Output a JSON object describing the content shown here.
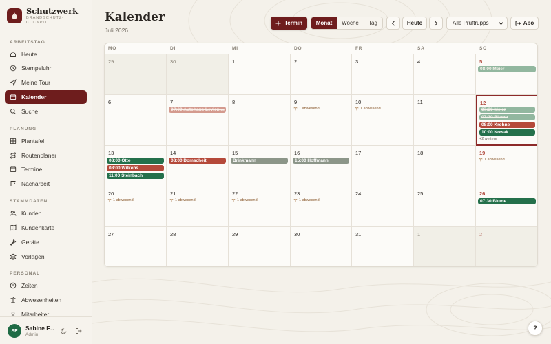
{
  "brand": {
    "title": "Schutzwerk",
    "subtitle": "BRANDSCHUTZ-COCKPIT"
  },
  "sidebar": {
    "sections": [
      "ARBEITSTAG",
      "PLANUNG",
      "STAMMDATEN",
      "PERSONAL"
    ],
    "items": [
      {
        "label": "Heute",
        "icon": "home-icon"
      },
      {
        "label": "Stempeluhr",
        "icon": "clock-icon"
      },
      {
        "label": "Meine Tour",
        "icon": "send-icon"
      },
      {
        "label": "Kalender",
        "icon": "calendar-icon",
        "active": true
      },
      {
        "label": "Suche",
        "icon": "search-icon"
      },
      {
        "label": "Plantafel",
        "icon": "grid-icon"
      },
      {
        "label": "Routenplaner",
        "icon": "route-icon"
      },
      {
        "label": "Termine",
        "icon": "calendar-icon"
      },
      {
        "label": "Nacharbeit",
        "icon": "flag-icon"
      },
      {
        "label": "Kunden",
        "icon": "users-icon"
      },
      {
        "label": "Kundenkarte",
        "icon": "map-icon"
      },
      {
        "label": "Geräte",
        "icon": "wrench-icon"
      },
      {
        "label": "Vorlagen",
        "icon": "layers-icon"
      },
      {
        "label": "Zeiten",
        "icon": "clock-icon"
      },
      {
        "label": "Abwesenheiten",
        "icon": "palm-icon"
      },
      {
        "label": "Mitarbeiter",
        "icon": "user-icon"
      }
    ]
  },
  "user": {
    "initials": "SF",
    "name": "Sabine F...",
    "role": "Admin"
  },
  "header": {
    "title": "Kalender",
    "subtitle": "Juli 2026",
    "new_button": "Termin",
    "views": [
      "Monat",
      "Woche",
      "Tag"
    ],
    "active_view": "Monat",
    "today_button": "Heute",
    "filter_value": "Alle Prüftrupps",
    "abo_button": "Abo"
  },
  "calendar": {
    "weekdays": [
      "MO",
      "DI",
      "MI",
      "DO",
      "FR",
      "SA",
      "SO"
    ],
    "weeks": [
      [
        {
          "day": "29",
          "other": true
        },
        {
          "day": "30",
          "other": true
        },
        {
          "day": "1"
        },
        {
          "day": "2"
        },
        {
          "day": "3"
        },
        {
          "day": "4"
        },
        {
          "day": "5",
          "events": [
            {
              "label": "08:00 Meier",
              "style": "done"
            }
          ]
        }
      ],
      [
        {
          "day": "6"
        },
        {
          "day": "7",
          "events": [
            {
              "label": "07:00 Autohaus Levien ...",
              "style": "done-red"
            }
          ]
        },
        {
          "day": "8"
        },
        {
          "day": "9",
          "absent": "1 abwesend"
        },
        {
          "day": "10",
          "absent": "1 abwesend"
        },
        {
          "day": "11"
        },
        {
          "day": "12",
          "today": true,
          "events": [
            {
              "label": "07:30 Meier",
              "style": "done"
            },
            {
              "label": "07:30 Blume",
              "style": "done"
            },
            {
              "label": "08:00 Krohne",
              "style": "red"
            },
            {
              "label": "10:00 Nowak",
              "style": "green"
            }
          ],
          "more": "+2 weitere"
        }
      ],
      [
        {
          "day": "13",
          "events": [
            {
              "label": "08:00 Otte",
              "style": "green"
            },
            {
              "label": "08:00 Wilkens",
              "style": "red"
            },
            {
              "label": "11:00 Steinbach",
              "style": "green"
            }
          ]
        },
        {
          "day": "14",
          "events": [
            {
              "label": "08:00 Domscheit",
              "style": "red"
            }
          ]
        },
        {
          "day": "15",
          "events": [
            {
              "label": "Brinkmann",
              "style": "gray"
            }
          ]
        },
        {
          "day": "16",
          "events": [
            {
              "label": "15:00 Hoffmann",
              "style": "gray"
            }
          ]
        },
        {
          "day": "17"
        },
        {
          "day": "18"
        },
        {
          "day": "19",
          "absent": "1 abwesend"
        }
      ],
      [
        {
          "day": "20",
          "absent": "1 abwesend"
        },
        {
          "day": "21",
          "absent": "1 abwesend"
        },
        {
          "day": "22",
          "absent": "1 abwesend"
        },
        {
          "day": "23",
          "absent": "1 abwesend"
        },
        {
          "day": "24"
        },
        {
          "day": "25"
        },
        {
          "day": "26",
          "events": [
            {
              "label": "07:30 Blume",
              "style": "green"
            }
          ]
        }
      ],
      [
        {
          "day": "27"
        },
        {
          "day": "28"
        },
        {
          "day": "29"
        },
        {
          "day": "30"
        },
        {
          "day": "31"
        },
        {
          "day": "1",
          "other": true
        },
        {
          "day": "2",
          "other": true
        }
      ]
    ]
  },
  "help": "?",
  "colors": {
    "accent": "#6e1d1d",
    "green": "#24704b",
    "red": "#b5493a",
    "today_border": "#8d2a2a"
  }
}
